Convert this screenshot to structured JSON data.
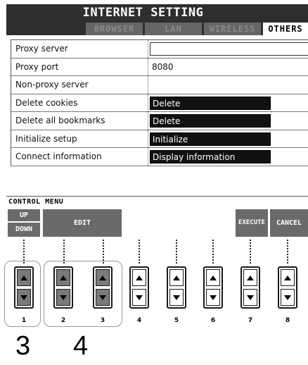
{
  "screen": {
    "title": "INTERNET SETTING",
    "tabs": [
      {
        "label": "BROWSER",
        "active": false
      },
      {
        "label": "LAN",
        "active": false
      },
      {
        "label": "WIRELESS",
        "active": false
      },
      {
        "label": "OTHERS",
        "active": true
      }
    ],
    "rows": [
      {
        "label": "Proxy server",
        "value": "",
        "kind": "input"
      },
      {
        "label": "Proxy port",
        "value": "8080",
        "kind": "plain"
      },
      {
        "label": "Non-proxy server",
        "value": "",
        "kind": "plain"
      },
      {
        "label": "Delete cookies",
        "value": "Delete",
        "kind": "button"
      },
      {
        "label": "Delete all bookmarks",
        "value": "Delete",
        "kind": "button"
      },
      {
        "label": "Initialize setup",
        "value": "Initialize",
        "kind": "button"
      },
      {
        "label": "Connect information",
        "value": "Display information",
        "kind": "button"
      }
    ]
  },
  "control_menu": {
    "title": "CONTROL MENU",
    "up": "UP",
    "down": "DOWN",
    "edit": "EDIT",
    "execute": "EXECUTE",
    "cancel": "CANCEL"
  },
  "panel_buttons": {
    "numbers": [
      "1",
      "2",
      "3",
      "4",
      "5",
      "6",
      "7",
      "8"
    ]
  },
  "callouts": [
    "3",
    "4"
  ],
  "colors": {
    "title_bar": "#2e2e2e",
    "lcd_gray": "#6f6f6f",
    "highlight_box": "#111111"
  }
}
